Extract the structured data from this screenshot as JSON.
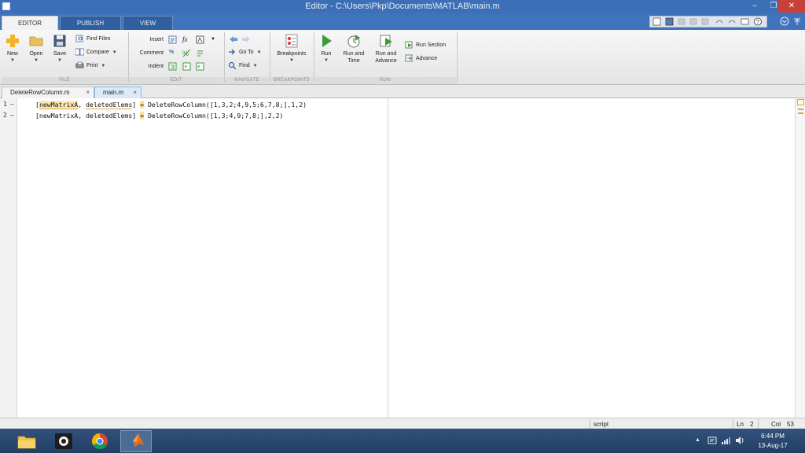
{
  "window": {
    "title": "Editor - C:\\Users\\Pkp\\Documents\\MATLAB\\main.m",
    "minimize_glyph": "–",
    "maximize_glyph": "❐",
    "close_glyph": "✕"
  },
  "ribbon_tabs": [
    {
      "label": "EDITOR",
      "active": true
    },
    {
      "label": "PUBLISH",
      "active": false
    },
    {
      "label": "VIEW",
      "active": false
    }
  ],
  "ribbon": {
    "file": {
      "section_label": "FILE",
      "new_label": "New",
      "open_label": "Open",
      "save_label": "Save",
      "find_files_label": "Find Files",
      "compare_label": "Compare",
      "print_label": "Print"
    },
    "edit": {
      "section_label": "EDIT",
      "insert_label": "Insert",
      "comment_label": "Comment",
      "indent_label": "Indent",
      "fx_glyph": "fx",
      "percent_glyph": "%"
    },
    "navigate": {
      "section_label": "NAVIGATE",
      "goto_label": "Go To",
      "find_label": "Find"
    },
    "breakpoints": {
      "section_label": "BREAKPOINTS",
      "breakpoints_label": "Breakpoints"
    },
    "run": {
      "section_label": "RUN",
      "run_label": "Run",
      "run_and_time_label_1": "Run and",
      "run_and_time_label_2": "Time",
      "run_and_advance_label_1": "Run and",
      "run_and_advance_label_2": "Advance",
      "run_section_label": "Run Section",
      "advance_label": "Advance"
    },
    "dropdown_glyph": "▼"
  },
  "document_tabs": [
    {
      "label": "DeleteRowColumn.m",
      "active": false,
      "close_glyph": "×"
    },
    {
      "label": "main.m",
      "active": true,
      "close_glyph": "×"
    }
  ],
  "editor": {
    "lines": [
      {
        "number": "1",
        "dash": "–",
        "open_bracket": "[",
        "var1": "newMatrixA",
        "sep": ", ",
        "var2": "deletedElems",
        "close": "] ",
        "eq": "=",
        "rest": " DeleteRowColumn([1,3,2;4,9,5;6,7,8;],1,2)"
      },
      {
        "number": "2",
        "dash": "–",
        "text_before": "[newMatrixA, deletedElems] ",
        "eq": "=",
        "rest": " DeleteRowColumn([1,3;4,9;7,8;],2,2)"
      }
    ]
  },
  "status": {
    "mode": "script",
    "ln_label": "Ln",
    "ln_value": "2",
    "col_label": "Col",
    "col_value": "53"
  },
  "taskbar": {
    "clock_time": "6:44 PM",
    "clock_date": "13-Aug-17",
    "tray_up_glyph": "▲"
  },
  "colors": {
    "titlebar": "#3c6fb6",
    "matlab_orange": "#e8a33c",
    "run_green": "#3f9b3a"
  }
}
